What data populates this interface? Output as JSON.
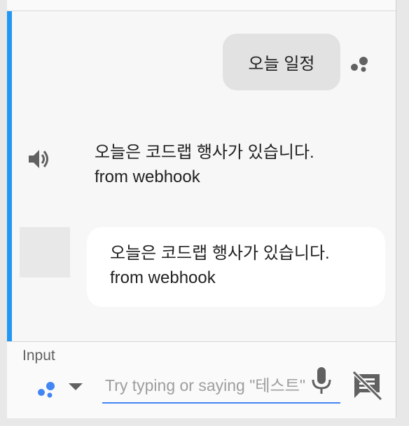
{
  "conversation": {
    "user_query": "오늘 일정",
    "speech_response": {
      "line1": "오늘은 코드랩 행사가 있습니다.",
      "line2": "from webhook"
    },
    "card_response": {
      "line1": "오늘은 코드랩 행사가 있습니다.",
      "line2": "from webhook"
    }
  },
  "input_bar": {
    "label": "Input",
    "placeholder": "Try typing or saying \"테스트\""
  },
  "colors": {
    "accent": "#2196f3",
    "input_underline": "#4285f4",
    "user_bubble": "#e2e2e2"
  },
  "icons": {
    "assistant": "assistant-dots-icon",
    "speaker": "speaker-icon",
    "input_mode": "assistant-dots-icon",
    "dropdown": "caret-down-icon",
    "mic": "mic-icon",
    "no_chat": "chat-off-icon"
  }
}
